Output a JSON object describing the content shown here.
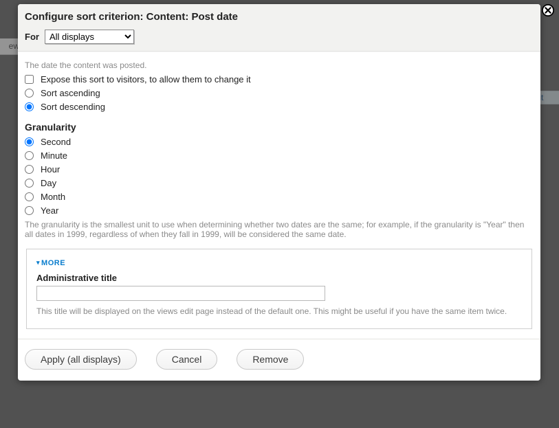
{
  "background": {
    "left_text": "ew",
    "edit_link": "edit"
  },
  "dialog": {
    "title": "Configure sort criterion: Content: Post date",
    "for_label": "For",
    "for_select": {
      "value": "All displays",
      "options": [
        "All displays"
      ]
    },
    "description": "The date the content was posted.",
    "expose": {
      "label": "Expose this sort to visitors, to allow them to change it",
      "checked": false
    },
    "sort_order": {
      "options": [
        {
          "key": "asc",
          "label": "Sort ascending",
          "checked": false
        },
        {
          "key": "desc",
          "label": "Sort descending",
          "checked": true
        }
      ]
    },
    "granularity": {
      "heading": "Granularity",
      "options": [
        {
          "key": "second",
          "label": "Second",
          "checked": true
        },
        {
          "key": "minute",
          "label": "Minute",
          "checked": false
        },
        {
          "key": "hour",
          "label": "Hour",
          "checked": false
        },
        {
          "key": "day",
          "label": "Day",
          "checked": false
        },
        {
          "key": "month",
          "label": "Month",
          "checked": false
        },
        {
          "key": "year",
          "label": "Year",
          "checked": false
        }
      ],
      "help": "The granularity is the smallest unit to use when determining whether two dates are the same; for example, if the granularity is \"Year\" then all dates in 1999, regardless of when they fall in 1999, will be considered the same date."
    },
    "more": {
      "toggle_label": "MORE",
      "admin_title_label": "Administrative title",
      "admin_title_value": "",
      "admin_title_help": "This title will be displayed on the views edit page instead of the default one. This might be useful if you have the same item twice."
    },
    "buttons": {
      "apply": "Apply (all displays)",
      "cancel": "Cancel",
      "remove": "Remove"
    }
  }
}
